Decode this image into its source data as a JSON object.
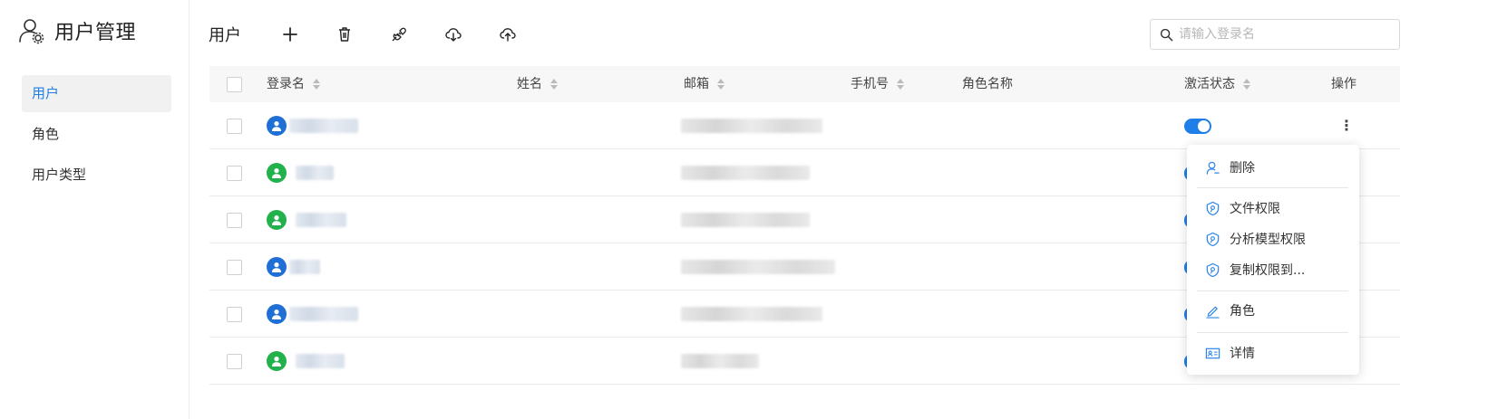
{
  "app": {
    "title": "用户管理"
  },
  "sidebar": {
    "items": [
      {
        "label": "用户",
        "active": true
      },
      {
        "label": "角色",
        "active": false
      },
      {
        "label": "用户类型",
        "active": false
      }
    ]
  },
  "toolbar": {
    "title": "用户",
    "buttons": [
      {
        "name": "add-button",
        "icon": "plus-icon"
      },
      {
        "name": "delete-button",
        "icon": "trash-icon"
      },
      {
        "name": "link-button",
        "icon": "plug-icon"
      },
      {
        "name": "download-button",
        "icon": "cloud-download-icon"
      },
      {
        "name": "upload-button",
        "icon": "cloud-upload-icon"
      }
    ]
  },
  "search": {
    "placeholder": "请输入登录名",
    "value": ""
  },
  "table": {
    "headers": {
      "login": "登录名",
      "name": "姓名",
      "email": "邮箱",
      "phone": "手机号",
      "role": "角色名称",
      "status": "激活状态",
      "actions": "操作"
    },
    "rows": [
      {
        "avatar_color": "#1f6fd6",
        "login": "",
        "email": "",
        "active": true
      },
      {
        "avatar_color": "#22b14c",
        "login": "",
        "email": "",
        "active": true
      },
      {
        "avatar_color": "#22b14c",
        "login": "",
        "email": "",
        "active": true
      },
      {
        "avatar_color": "#1f6fd6",
        "login": "",
        "email": "",
        "active": true
      },
      {
        "avatar_color": "#1f6fd6",
        "login": "",
        "email": "",
        "active": true
      },
      {
        "avatar_color": "#22b14c",
        "login": "",
        "email": "",
        "active": true
      }
    ]
  },
  "menu": {
    "items": [
      {
        "label": "删除",
        "icon": "user-remove-icon"
      },
      {
        "label": "文件权限",
        "icon": "shield-key-icon"
      },
      {
        "label": "分析模型权限",
        "icon": "shield-key-icon"
      },
      {
        "label": "复制权限到...",
        "icon": "shield-key-icon"
      },
      {
        "label": "角色",
        "icon": "pencil-icon"
      },
      {
        "label": "详情",
        "icon": "id-card-icon"
      }
    ]
  },
  "colors": {
    "accent": "#1f7ee8",
    "user_blue": "#1f6fd6",
    "user_green": "#22b14c"
  }
}
